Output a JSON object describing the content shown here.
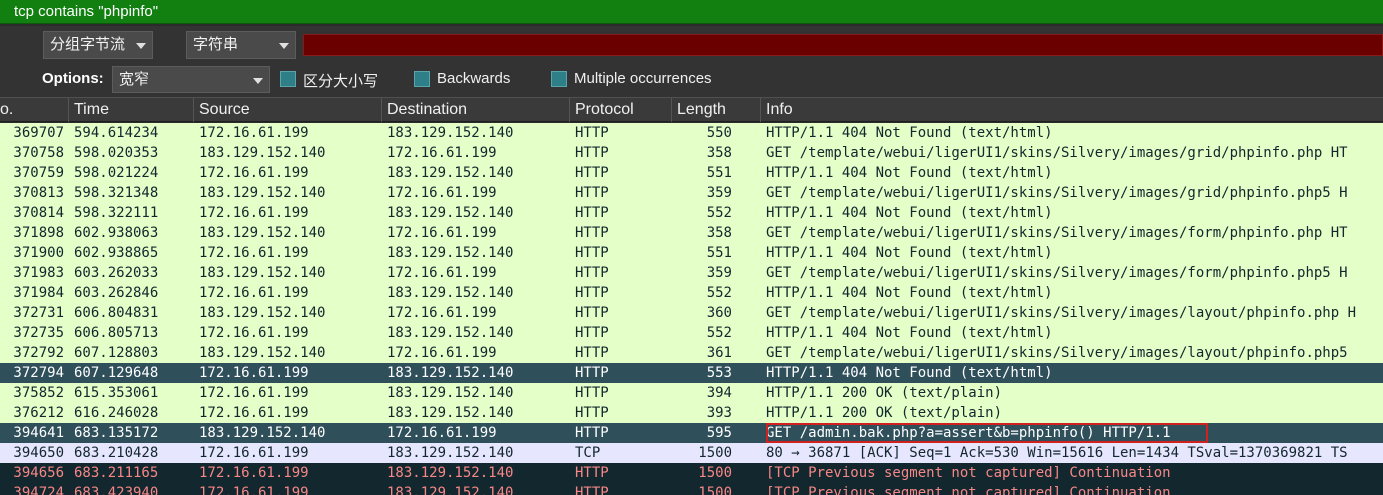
{
  "filter": {
    "text": "tcp contains \"phpinfo\""
  },
  "find_bar": {
    "display_combo": "分组字节流",
    "type_combo": "字符串",
    "options_label": "Options:",
    "width_combo": "宽窄",
    "case_sensitive_label": "区分大小写",
    "backwards_label": "Backwards",
    "multiple_label": "Multiple occurrences"
  },
  "columns": [
    "o.",
    "Time",
    "Source",
    "Destination",
    "Protocol",
    "Length",
    "Info"
  ],
  "colors": {
    "row_http_bg": "#e4ffc7",
    "row_http_fg": "#12272e",
    "row_selected_bg": "#2f4f5b",
    "row_selected_fg": "#ffffff",
    "row_tcp_bg": "#e7e6ff",
    "row_tcp_fg": "#12272e",
    "row_bad_bg": "#12272e",
    "row_bad_fg": "#f78787",
    "highlight_border": "#d02020"
  },
  "packets": [
    {
      "no": "369707",
      "time": "594.614234",
      "src": "172.16.61.199",
      "dst": "183.129.152.140",
      "proto": "HTTP",
      "len": "550",
      "info": "HTTP/1.1 404 Not Found  (text/html)",
      "style": "http"
    },
    {
      "no": "370758",
      "time": "598.020353",
      "src": "183.129.152.140",
      "dst": "172.16.61.199",
      "proto": "HTTP",
      "len": "358",
      "info": "GET /template/webui/ligerUI1/skins/Silvery/images/grid/phpinfo.php HT",
      "style": "http"
    },
    {
      "no": "370759",
      "time": "598.021224",
      "src": "172.16.61.199",
      "dst": "183.129.152.140",
      "proto": "HTTP",
      "len": "551",
      "info": "HTTP/1.1 404 Not Found  (text/html)",
      "style": "http"
    },
    {
      "no": "370813",
      "time": "598.321348",
      "src": "183.129.152.140",
      "dst": "172.16.61.199",
      "proto": "HTTP",
      "len": "359",
      "info": "GET /template/webui/ligerUI1/skins/Silvery/images/grid/phpinfo.php5 H",
      "style": "http"
    },
    {
      "no": "370814",
      "time": "598.322111",
      "src": "172.16.61.199",
      "dst": "183.129.152.140",
      "proto": "HTTP",
      "len": "552",
      "info": "HTTP/1.1 404 Not Found  (text/html)",
      "style": "http"
    },
    {
      "no": "371898",
      "time": "602.938063",
      "src": "183.129.152.140",
      "dst": "172.16.61.199",
      "proto": "HTTP",
      "len": "358",
      "info": "GET /template/webui/ligerUI1/skins/Silvery/images/form/phpinfo.php HT",
      "style": "http"
    },
    {
      "no": "371900",
      "time": "602.938865",
      "src": "172.16.61.199",
      "dst": "183.129.152.140",
      "proto": "HTTP",
      "len": "551",
      "info": "HTTP/1.1 404 Not Found  (text/html)",
      "style": "http"
    },
    {
      "no": "371983",
      "time": "603.262033",
      "src": "183.129.152.140",
      "dst": "172.16.61.199",
      "proto": "HTTP",
      "len": "359",
      "info": "GET /template/webui/ligerUI1/skins/Silvery/images/form/phpinfo.php5 H",
      "style": "http"
    },
    {
      "no": "371984",
      "time": "603.262846",
      "src": "172.16.61.199",
      "dst": "183.129.152.140",
      "proto": "HTTP",
      "len": "552",
      "info": "HTTP/1.1 404 Not Found  (text/html)",
      "style": "http"
    },
    {
      "no": "372731",
      "time": "606.804831",
      "src": "183.129.152.140",
      "dst": "172.16.61.199",
      "proto": "HTTP",
      "len": "360",
      "info": "GET /template/webui/ligerUI1/skins/Silvery/images/layout/phpinfo.php H",
      "style": "http"
    },
    {
      "no": "372735",
      "time": "606.805713",
      "src": "172.16.61.199",
      "dst": "183.129.152.140",
      "proto": "HTTP",
      "len": "552",
      "info": "HTTP/1.1 404 Not Found  (text/html)",
      "style": "http"
    },
    {
      "no": "372792",
      "time": "607.128803",
      "src": "183.129.152.140",
      "dst": "172.16.61.199",
      "proto": "HTTP",
      "len": "361",
      "info": "GET /template/webui/ligerUI1/skins/Silvery/images/layout/phpinfo.php5",
      "style": "http"
    },
    {
      "no": "372794",
      "time": "607.129648",
      "src": "172.16.61.199",
      "dst": "183.129.152.140",
      "proto": "HTTP",
      "len": "553",
      "info": "HTTP/1.1 404 Not Found  (text/html)",
      "style": "selected"
    },
    {
      "no": "375852",
      "time": "615.353061",
      "src": "172.16.61.199",
      "dst": "183.129.152.140",
      "proto": "HTTP",
      "len": "394",
      "info": "HTTP/1.1 200 OK  (text/plain)",
      "style": "http"
    },
    {
      "no": "376212",
      "time": "616.246028",
      "src": "172.16.61.199",
      "dst": "183.129.152.140",
      "proto": "HTTP",
      "len": "393",
      "info": "HTTP/1.1 200 OK  (text/plain)",
      "style": "http"
    },
    {
      "no": "394641",
      "time": "683.135172",
      "src": "183.129.152.140",
      "dst": "172.16.61.199",
      "proto": "HTTP",
      "len": "595",
      "info": "GET /admin.bak.php?a=assert&b=phpinfo() HTTP/1.1",
      "style": "selected",
      "boxed": true
    },
    {
      "no": "394650",
      "time": "683.210428",
      "src": "172.16.61.199",
      "dst": "183.129.152.140",
      "proto": "TCP",
      "len": "1500",
      "info": "80 → 36871 [ACK] Seq=1 Ack=530 Win=15616 Len=1434 TSval=1370369821 TS",
      "style": "tcp"
    },
    {
      "no": "394656",
      "time": "683.211165",
      "src": "172.16.61.199",
      "dst": "183.129.152.140",
      "proto": "HTTP",
      "len": "1500",
      "info": "[TCP Previous segment not captured] Continuation",
      "style": "bad"
    },
    {
      "no": "394724",
      "time": "683.423940",
      "src": "172.16.61.199",
      "dst": "183.129.152.140",
      "proto": "HTTP",
      "len": "1500",
      "info": "[TCP Previous segment not captured] Continuation",
      "style": "bad"
    }
  ]
}
